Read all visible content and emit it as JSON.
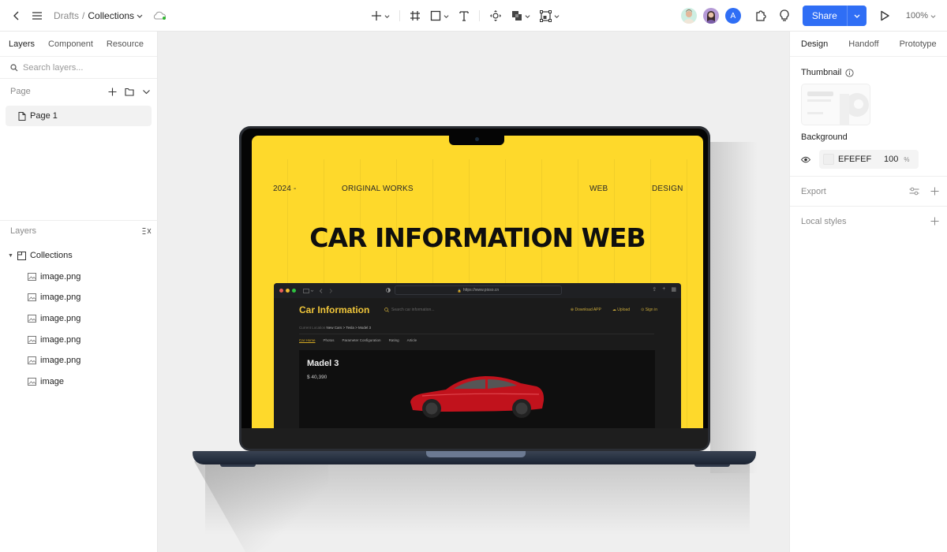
{
  "topbar": {
    "breadcrumb": {
      "root": "Drafts",
      "separator": "/",
      "current": "Collections"
    },
    "tools": [
      "add-tool",
      "frame-tool",
      "shape-tool",
      "text-tool",
      "component-tool",
      "boolean-tool",
      "mask-tool"
    ],
    "avatars": [
      {
        "type": "photo",
        "color": "#cdeee2"
      },
      {
        "type": "photo",
        "color": "#b59ad6"
      },
      {
        "type": "initial",
        "initial": "A",
        "color": "#2f6ef5"
      }
    ],
    "share_label": "Share",
    "zoom_level": "100%"
  },
  "left_panel": {
    "tabs": [
      {
        "label": "Layers",
        "active": true
      },
      {
        "label": "Component",
        "active": false
      },
      {
        "label": "Resource",
        "active": false
      }
    ],
    "search_placeholder": "Search layers...",
    "page_section_label": "Page",
    "pages": [
      {
        "label": "Page 1",
        "selected": true
      }
    ],
    "layers_section_label": "Layers",
    "layers": {
      "root": "Collections",
      "children": [
        "image.png",
        "image.png",
        "image.png",
        "image.png",
        "image.png",
        "image"
      ]
    }
  },
  "right_panel": {
    "tabs": [
      {
        "label": "Design",
        "active": true
      },
      {
        "label": "Handoff",
        "active": false
      },
      {
        "label": "Prototype",
        "active": false
      }
    ],
    "thumbnail_label": "Thumbnail",
    "background_label": "Background",
    "background_hex": "EFEFEF",
    "background_opacity": "100",
    "background_opacity_unit": "%",
    "export_label": "Export",
    "local_styles_label": "Local styles"
  },
  "canvas": {
    "mockup": {
      "nav_year": "2024 -",
      "nav_original": "ORIGINAL WORKS",
      "nav_web": "WEB",
      "nav_design": "DESIGN",
      "hero_title": "CAR INFORMATION WEB",
      "accent_color": "#fed92b",
      "browser": {
        "url": "https://www.pixso.cn",
        "site_title": "Car Information",
        "search_placeholder": "Search car information...",
        "actions": [
          "Download APP",
          "Upload",
          "Sign in"
        ],
        "location_label": "Current Location",
        "location_path": "New Cars > Tesla > Model 3",
        "tabs": [
          {
            "label": "Car Home",
            "active": true
          },
          {
            "label": "Photos",
            "active": false
          },
          {
            "label": "Parameter Configuration",
            "active": false
          },
          {
            "label": "Rating",
            "active": false
          },
          {
            "label": "Article",
            "active": false
          }
        ],
        "model_name": "Madel 3",
        "model_price": "$ 40,390"
      }
    }
  }
}
